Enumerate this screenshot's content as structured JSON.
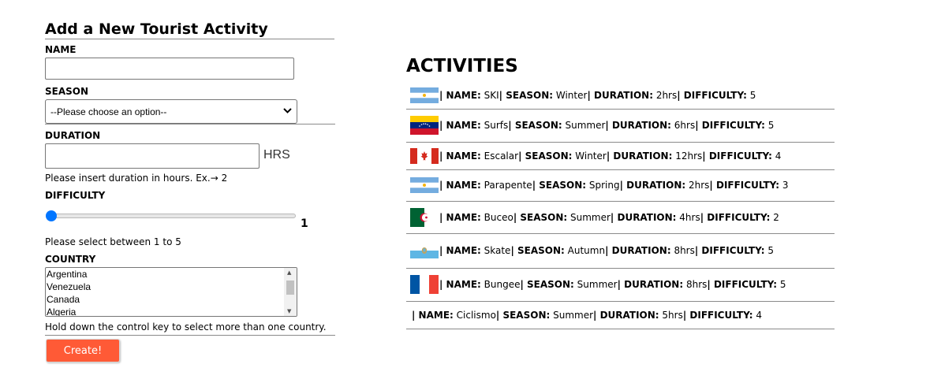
{
  "form": {
    "title": "Add a New Tourist Activity",
    "name_label": "NAME",
    "name_value": "",
    "season_label": "SEASON",
    "season_selected": "--Please choose an option--",
    "duration_label": "DURATION",
    "duration_value": "",
    "duration_unit": "HRS",
    "duration_hint": "Please insert duration in hours. Ex.→ 2",
    "difficulty_label": "DIFFICULTY",
    "difficulty_value": "1",
    "difficulty_hint": "Please select between 1 to 5",
    "country_label": "COUNTRY",
    "countries": [
      "Argentina",
      "Venezuela",
      "Canada",
      "Algeria"
    ],
    "country_hint": "Hold down the control key to select more than one country.",
    "create_label": "Create!"
  },
  "activities": {
    "title": "ACTIVITIES",
    "labels": {
      "name": "NAME:",
      "season": "SEASON:",
      "duration": "DURATION:",
      "difficulty": "DIFFICULTY:",
      "sep": "|"
    },
    "items": [
      {
        "flag": "argentina-flag",
        "name": "SKI",
        "season": "Winter",
        "duration": "2hrs",
        "difficulty": "5"
      },
      {
        "flag": "venezuela-flag",
        "name": "Surfs",
        "season": "Summer",
        "duration": "6hrs",
        "difficulty": "5"
      },
      {
        "flag": "canada-flag",
        "name": "Escalar",
        "season": "Winter",
        "duration": "12hrs",
        "difficulty": "4"
      },
      {
        "flag": "argentina-flag",
        "name": "Parapente",
        "season": "Spring",
        "duration": "2hrs",
        "difficulty": "3"
      },
      {
        "flag": "algeria-flag",
        "name": "Buceo",
        "season": "Summer",
        "duration": "4hrs",
        "difficulty": "2"
      },
      {
        "flag": "san-marino-flag",
        "name": "Skate",
        "season": "Autumn",
        "duration": "8hrs",
        "difficulty": "5"
      },
      {
        "flag": "france-flag",
        "name": "Bungee",
        "season": "Summer",
        "duration": "8hrs",
        "difficulty": "5"
      },
      {
        "flag": "",
        "name": "Ciclismo",
        "season": "Summer",
        "duration": "5hrs",
        "difficulty": "4"
      }
    ]
  },
  "colors": {
    "accent_button": "#ff5a36",
    "slider": "#0075ff"
  }
}
